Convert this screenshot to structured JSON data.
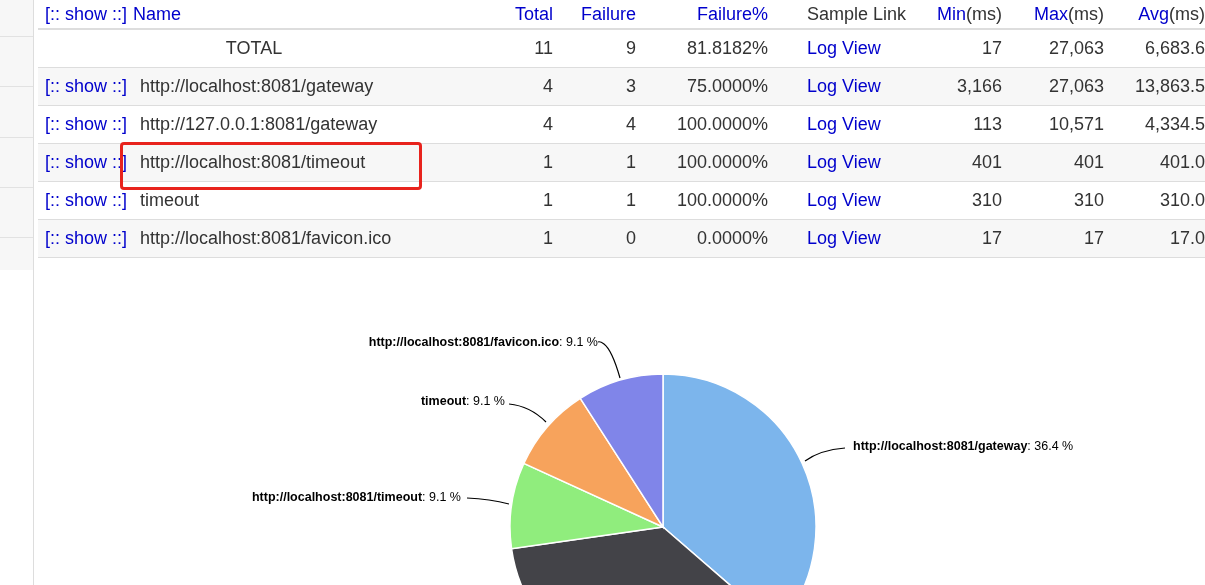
{
  "table": {
    "header": {
      "show_link": "[:: show ::]",
      "name": "Name",
      "total": "Total",
      "failure": "Failure",
      "failure_pct": "Failure%",
      "sample_link": "Sample Link",
      "min": "Min",
      "min_unit": "(ms)",
      "max": "Max",
      "max_unit": "(ms)",
      "avg": "Avg",
      "avg_unit": "(ms)"
    },
    "total_row": {
      "name": "TOTAL",
      "total": "11",
      "failure": "9",
      "failure_pct": "81.8182%",
      "sample_link": "Log View",
      "min": "17",
      "max": "27,063",
      "avg": "6,683.6"
    },
    "rows": [
      {
        "show_link": "[:: show ::]",
        "name": "http://localhost:8081/gateway",
        "total": "4",
        "failure": "3",
        "failure_pct": "75.0000%",
        "sample_link": "Log View",
        "min": "3,166",
        "max": "27,063",
        "avg": "13,863.5",
        "highlighted": false
      },
      {
        "show_link": "[:: show ::]",
        "name": "http://127.0.0.1:8081/gateway",
        "total": "4",
        "failure": "4",
        "failure_pct": "100.0000%",
        "sample_link": "Log View",
        "min": "113",
        "max": "10,571",
        "avg": "4,334.5",
        "highlighted": false
      },
      {
        "show_link": "[:: show ::]",
        "name": "http://localhost:8081/timeout",
        "total": "1",
        "failure": "1",
        "failure_pct": "100.0000%",
        "sample_link": "Log View",
        "min": "401",
        "max": "401",
        "avg": "401.0",
        "highlighted": true
      },
      {
        "show_link": "[:: show ::]",
        "name": "timeout",
        "total": "1",
        "failure": "1",
        "failure_pct": "100.0000%",
        "sample_link": "Log View",
        "min": "310",
        "max": "310",
        "avg": "310.0",
        "highlighted": false
      },
      {
        "show_link": "[:: show ::]",
        "name": "http://localhost:8081/favicon.ico",
        "total": "1",
        "failure": "0",
        "failure_pct": "0.0000%",
        "sample_link": "Log View",
        "min": "17",
        "max": "17",
        "avg": "17.0",
        "highlighted": false
      }
    ]
  },
  "chart": {
    "chart_data": {
      "type": "pie",
      "categories": [
        "http://localhost:8081/gateway",
        null,
        "http://localhost:8081/timeout",
        "timeout",
        "http://localhost:8081/favicon.ico"
      ],
      "values": [
        36.4,
        36.4,
        9.1,
        9.1,
        9.1
      ],
      "colors": [
        "#7cb5ec",
        "#434348",
        "#90ed7d",
        "#f7a35c",
        "#8085e9"
      ],
      "value_labels": [
        ": 36.4 %",
        null,
        ": 9.1 %",
        ": 9.1 %",
        ": 9.1 %"
      ]
    }
  }
}
